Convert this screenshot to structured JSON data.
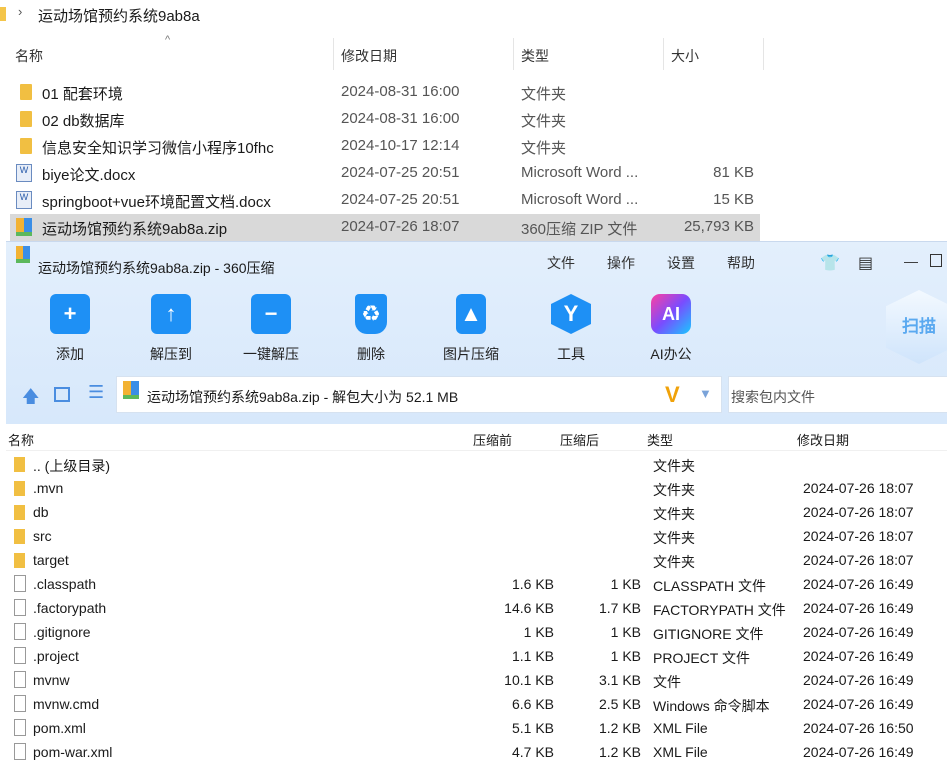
{
  "explorer": {
    "breadcrumb": "运动场馆预约系统9ab8a",
    "headers": {
      "name": "名称",
      "modified": "修改日期",
      "type": "类型",
      "size": "大小"
    },
    "rows": [
      {
        "icon": "folder",
        "name": "01 配套环境",
        "modified": "2024-08-31 16:00",
        "type": "文件夹",
        "size": ""
      },
      {
        "icon": "folder",
        "name": "02 db数据库",
        "modified": "2024-08-31 16:00",
        "type": "文件夹",
        "size": ""
      },
      {
        "icon": "folder",
        "name": "信息安全知识学习微信小程序10fhc",
        "modified": "2024-10-17 12:14",
        "type": "文件夹",
        "size": ""
      },
      {
        "icon": "docx",
        "name": "biye论文.docx",
        "modified": "2024-07-25 20:51",
        "type": "Microsoft Word ...",
        "size": "81 KB"
      },
      {
        "icon": "docx",
        "name": "springboot+vue环境配置文档.docx",
        "modified": "2024-07-25 20:51",
        "type": "Microsoft Word ...",
        "size": "15 KB"
      },
      {
        "icon": "zip",
        "name": "运动场馆预约系统9ab8a.zip",
        "modified": "2024-07-26 18:07",
        "type": "360压缩 ZIP 文件",
        "size": "25,793 KB",
        "selected": true
      }
    ]
  },
  "zipwin": {
    "title": "运动场馆预约系统9ab8a.zip - 360压缩",
    "menu": [
      "文件",
      "操作",
      "设置",
      "帮助"
    ],
    "toolbar": [
      "添加",
      "解压到",
      "一键解压",
      "删除",
      "图片压缩",
      "工具",
      "AI办公"
    ],
    "scan": "扫描",
    "address": "运动场馆预约系统9ab8a.zip - 解包大小为 52.1 MB",
    "search_placeholder": "搜索包内文件",
    "headers": {
      "name": "名称",
      "before": "压缩前",
      "after": "压缩后",
      "type": "类型",
      "modified": "修改日期"
    },
    "rows": [
      {
        "icon": "folder",
        "name": ".. (上级目录)",
        "before": "",
        "after": "",
        "type": "文件夹",
        "modified": ""
      },
      {
        "icon": "folder",
        "name": ".mvn",
        "before": "",
        "after": "",
        "type": "文件夹",
        "modified": "2024-07-26 18:07"
      },
      {
        "icon": "folder",
        "name": "db",
        "before": "",
        "after": "",
        "type": "文件夹",
        "modified": "2024-07-26 18:07"
      },
      {
        "icon": "folder",
        "name": "src",
        "before": "",
        "after": "",
        "type": "文件夹",
        "modified": "2024-07-26 18:07"
      },
      {
        "icon": "folder",
        "name": "target",
        "before": "",
        "after": "",
        "type": "文件夹",
        "modified": "2024-07-26 18:07"
      },
      {
        "icon": "file",
        "name": ".classpath",
        "before": "1.6 KB",
        "after": "1 KB",
        "type": "CLASSPATH 文件",
        "modified": "2024-07-26 16:49"
      },
      {
        "icon": "file",
        "name": ".factorypath",
        "before": "14.6 KB",
        "after": "1.7 KB",
        "type": "FACTORYPATH 文件",
        "modified": "2024-07-26 16:49"
      },
      {
        "icon": "file",
        "name": ".gitignore",
        "before": "1 KB",
        "after": "1 KB",
        "type": "GITIGNORE 文件",
        "modified": "2024-07-26 16:49"
      },
      {
        "icon": "file",
        "name": ".project",
        "before": "1.1 KB",
        "after": "1 KB",
        "type": "PROJECT 文件",
        "modified": "2024-07-26 16:49"
      },
      {
        "icon": "file",
        "name": "mvnw",
        "before": "10.1 KB",
        "after": "3.1 KB",
        "type": "文件",
        "modified": "2024-07-26 16:49"
      },
      {
        "icon": "cmd",
        "name": "mvnw.cmd",
        "before": "6.6 KB",
        "after": "2.5 KB",
        "type": "Windows 命令脚本",
        "modified": "2024-07-26 16:49"
      },
      {
        "icon": "file",
        "name": "pom.xml",
        "before": "5.1 KB",
        "after": "1.2 KB",
        "type": "XML File",
        "modified": "2024-07-26 16:50"
      },
      {
        "icon": "file",
        "name": "pom-war.xml",
        "before": "4.7 KB",
        "after": "1.2 KB",
        "type": "XML File",
        "modified": "2024-07-26 16:49"
      }
    ]
  }
}
